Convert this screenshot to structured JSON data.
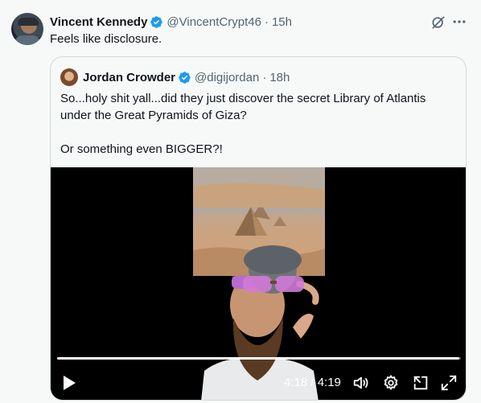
{
  "tweet": {
    "author_name": "Vincent Kennedy",
    "author_handle": "@VincentCrypt46",
    "separator": "·",
    "time": "15h",
    "text": "Feels like disclosure."
  },
  "quoted_tweet": {
    "author_name": "Jordan Crowder",
    "author_handle": "@digijordan",
    "separator": "·",
    "time": "18h",
    "text_line1": "So...holy shit yall...did they just discover the secret Library of Atlantis under the Great Pyramids of Giza?",
    "text_line2": "Or something even BIGGER?!"
  },
  "video": {
    "time_display": "4:18 / 4:19",
    "progress_fraction": 0.996
  },
  "icons": {
    "verified": "verified-badge-icon",
    "grok": "grok-icon",
    "more": "more-icon",
    "play": "play-icon",
    "volume": "volume-icon",
    "settings": "gear-icon",
    "pip": "picture-in-picture-icon",
    "fullscreen": "fullscreen-icon"
  },
  "colors": {
    "verified_blue": "#1d9bf0",
    "secondary_text": "#536471",
    "primary_text": "#0f1419"
  }
}
